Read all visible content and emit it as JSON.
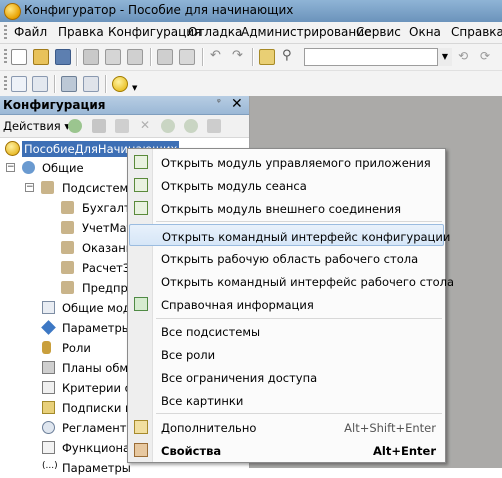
{
  "window": {
    "title": "Конфигуратор - Пособие для начинающих"
  },
  "menu": {
    "items": [
      "Файл",
      "Правка",
      "Конфигурация",
      "Отладка",
      "Администрирование",
      "Сервис",
      "Окна",
      "Справка"
    ]
  },
  "panel": {
    "title": "Конфигурация",
    "actions_label": "Действия",
    "tree": {
      "root": "ПособиеДляНачинающих",
      "common": "Общие",
      "subsystems": "Подсистемы",
      "subsystem_items": [
        "Бухгалте",
        "УчетМат",
        "Оказани",
        "РасчетЗ",
        "Предпри"
      ],
      "items": [
        "Общие моду",
        "Параметры",
        "Роли",
        "Планы обмен",
        "Критерии отб",
        "Подписки на",
        "Регламентн",
        "Функционал",
        "Параметры"
      ]
    }
  },
  "context_menu": {
    "items": [
      {
        "label": "Открыть модуль управляемого приложения",
        "icon": "module-icon"
      },
      {
        "label": "Открыть модуль сеанса",
        "icon": "module-icon"
      },
      {
        "label": "Открыть модуль внешнего соединения",
        "icon": "module-icon"
      },
      {
        "label": "Открыть командный интерфейс конфигурации",
        "highlighted": true
      },
      {
        "label": "Открыть рабочую область рабочего стола"
      },
      {
        "label": "Открыть командный интерфейс рабочего стола"
      },
      {
        "label": "Справочная информация",
        "icon": "help-info-icon"
      },
      {
        "label": "Все подсистемы"
      },
      {
        "label": "Все роли"
      },
      {
        "label": "Все ограничения доступа"
      },
      {
        "label": "Все картинки"
      },
      {
        "label": "Дополнительно",
        "shortcut": "Alt+Shift+Enter",
        "icon": "more-icon"
      },
      {
        "label": "Свойства",
        "shortcut": "Alt+Enter",
        "icon": "properties-icon",
        "bold": true
      }
    ]
  }
}
